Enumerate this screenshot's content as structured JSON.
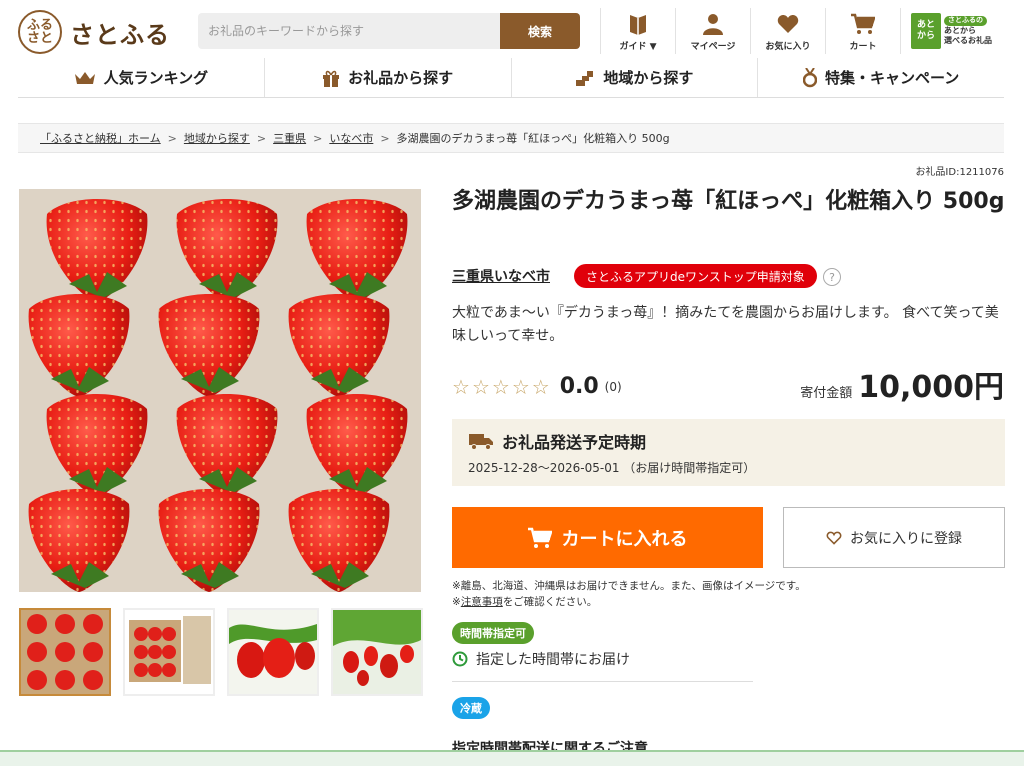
{
  "header": {
    "logo_mark": "ふる\nさと",
    "logo_text": "さとふる",
    "search": {
      "placeholder": "お礼品のキーワードから探す",
      "button": "検索"
    },
    "icons": [
      {
        "name": "guide-icon",
        "label": "ガイド ▼"
      },
      {
        "name": "mypage-icon",
        "label": "マイページ"
      },
      {
        "name": "heart-icon",
        "label": "お気に入り"
      },
      {
        "name": "cart-icon",
        "label": "カート"
      }
    ],
    "atokara": {
      "box": "あと\nから",
      "pill": "さとふるの",
      "line1": "あとから",
      "line2": "選べるお礼品"
    }
  },
  "nav": [
    {
      "name": "crown-icon",
      "label": "人気ランキング"
    },
    {
      "name": "gift-icon",
      "label": "お礼品から探す"
    },
    {
      "name": "region-icon",
      "label": "地域から探す"
    },
    {
      "name": "medal-icon",
      "label": "特集・キャンペーン"
    }
  ],
  "breadcrumb": [
    {
      "label": "「ふるさと納税」ホーム",
      "link": true
    },
    {
      "label": "地域から探す",
      "link": true
    },
    {
      "label": "三重県",
      "link": true
    },
    {
      "label": "いなべ市",
      "link": true
    },
    {
      "label": "多湖農園のデカうまっ苺「紅ほっぺ」化粧箱入り 500g",
      "link": false
    }
  ],
  "product": {
    "gift_id": "お礼品ID:1211076",
    "title": "多湖農園のデカうまっ苺「紅ほっぺ」化粧箱入り 500g",
    "region": "三重県いなべ市",
    "app_badge": "さとふるアプリdeワンストップ申請対象",
    "help": "?",
    "description": "大粒であま〜い『デカうまっ苺』！摘みたてを農園からお届けします。 食べて笑って美味しいって幸せ。",
    "rating": "0.0",
    "rating_count": "(0)",
    "rating_stars": 0,
    "price_label": "寄付金額",
    "price": "10,000円"
  },
  "shipping": {
    "title": "お礼品発送予定時期",
    "dates": "2025-12-28〜2026-05-01 （お届け時間帯指定可）"
  },
  "buttons": {
    "cart": "カートに入れる",
    "favorite": "お気に入りに登録"
  },
  "notes": {
    "line1": "※離島、北海道、沖縄県はお届けできません。また、画像はイメージです。",
    "line2_prefix": "※",
    "line2_link": "注意事項",
    "line2_suffix": "をご確認ください。"
  },
  "tags": {
    "time": "時間帯指定可",
    "time_text": "指定した時間帯にお届け",
    "cold": "冷蔵"
  },
  "notice_heading": "指定時間帯配送に関するご注意",
  "colors": {
    "brand": "#8a5a2b",
    "cart": "#ff6a00",
    "badge": "#e0000a",
    "time_tag": "#5aa02c",
    "cold_tag": "#1aa3e8"
  }
}
